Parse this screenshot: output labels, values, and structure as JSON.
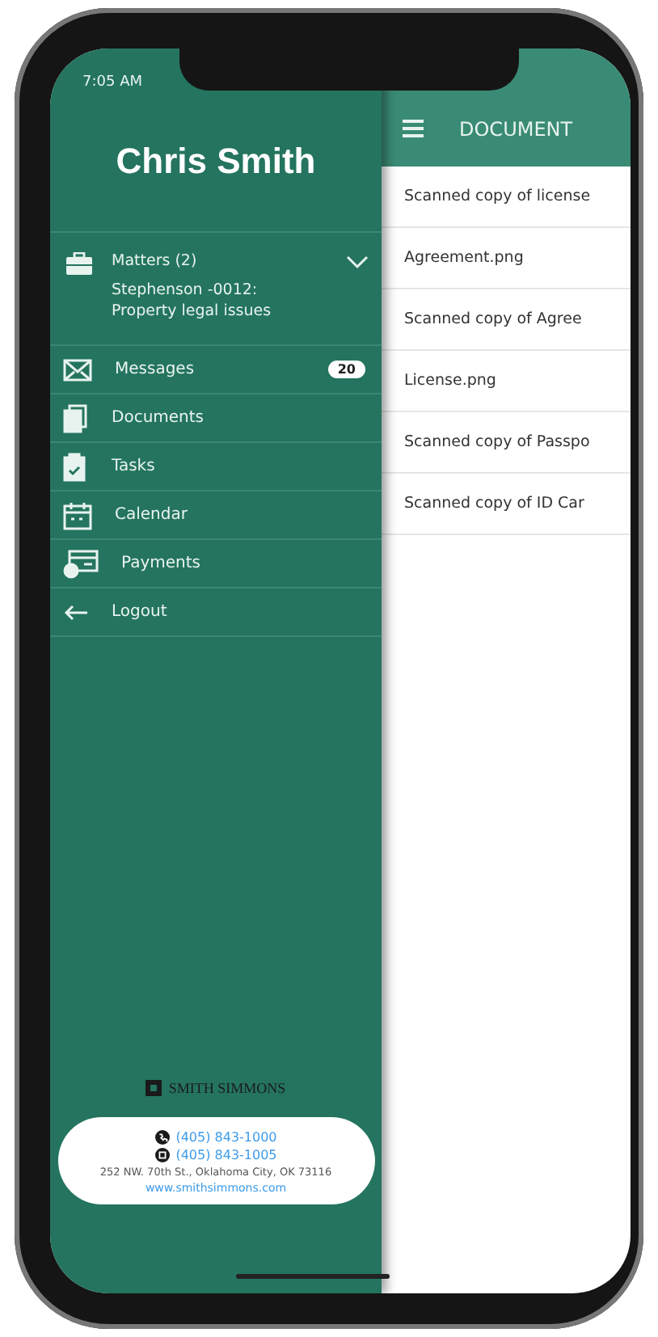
{
  "status_bar": {
    "time": "7:05 AM"
  },
  "drawer": {
    "user_name": "Chris Smith",
    "matters": {
      "label": "Matters (2)",
      "expanded": true,
      "current": "Stephenson -0012: Property legal issues"
    },
    "menu": [
      {
        "kind": "messages",
        "label": "Messages",
        "badge": "20"
      },
      {
        "kind": "documents",
        "label": "Documents"
      },
      {
        "kind": "tasks",
        "label": "Tasks"
      },
      {
        "kind": "calendar",
        "label": "Calendar"
      },
      {
        "kind": "payments",
        "label": "Payments"
      },
      {
        "kind": "logout",
        "label": "Logout"
      }
    ],
    "footer": {
      "brand": "SMITH SIMMONS",
      "phone": "(405) 843-1000",
      "fax": "(405) 843-1005",
      "address": "252 NW. 70th St., Oklahoma City, OK 73116",
      "website": "www.smithsimmons.com"
    }
  },
  "main": {
    "title": "DOCUMENT",
    "documents": [
      "Scanned copy of license",
      "Agreement.png",
      "Scanned copy of Agree",
      "License.png",
      "Scanned copy of Passpo",
      "Scanned copy of ID Car"
    ]
  }
}
